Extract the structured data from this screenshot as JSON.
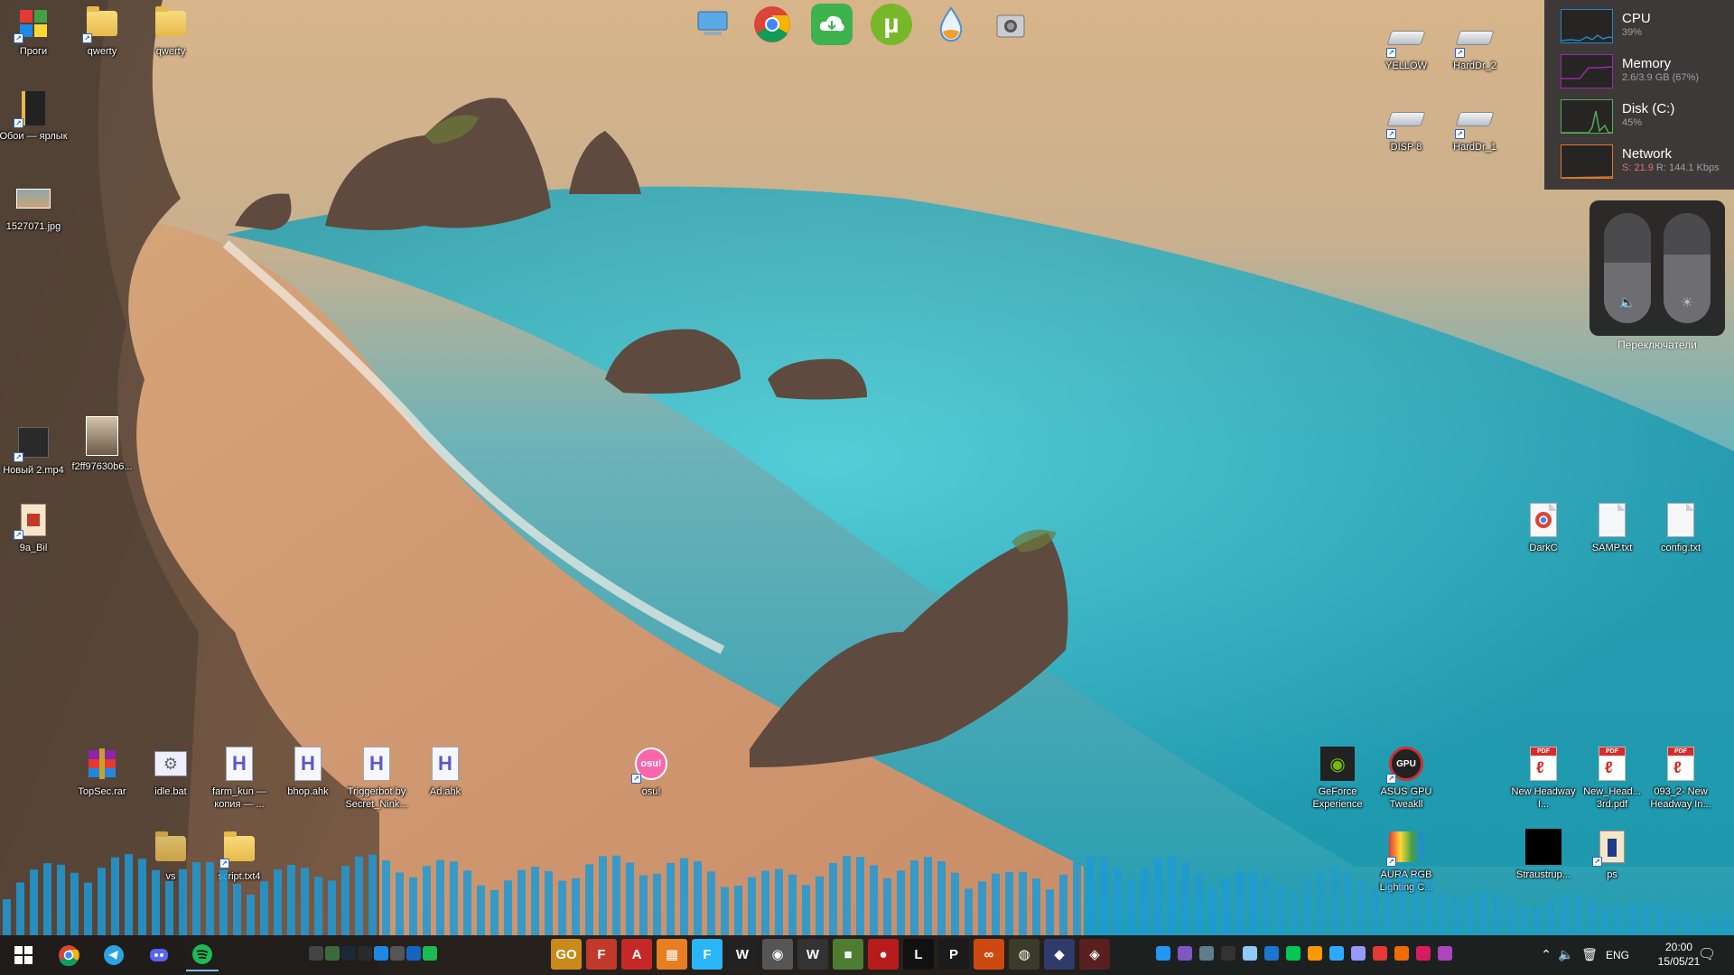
{
  "colors": {
    "accent_cpu": "#1e88c8",
    "accent_memory": "#9c27b0",
    "accent_disk": "#4caf50",
    "accent_network": "#e0782c",
    "visualizer_bar": "#1e9ad6",
    "taskbar_bg": "#1c1a18"
  },
  "desktop": {
    "left_icons": [
      {
        "label": "Проги",
        "icon": "apps-cube-icon"
      },
      {
        "label": "qwerty",
        "icon": "folder-icon"
      },
      {
        "label": "qwerty",
        "icon": "folder-icon"
      },
      {
        "label": "Обои — ярлык",
        "icon": "folder-shortcut-icon"
      },
      {
        "label": "1527071.jpg",
        "icon": "image-icon"
      },
      {
        "label": "Новый 2.mp4",
        "icon": "video-icon"
      },
      {
        "label": "f2ff97630b6...",
        "icon": "image-icon"
      },
      {
        "label": "9a_Bil",
        "icon": "archive-icon"
      }
    ],
    "bottom_icons": [
      {
        "label": "TopSec.rar",
        "icon": "winrar-icon"
      },
      {
        "label": "idle.bat",
        "icon": "batch-gear-icon"
      },
      {
        "label": "farm_kun — копия — ...",
        "icon": "ahk-file-icon"
      },
      {
        "label": "bhop.ahk",
        "icon": "ahk-file-icon"
      },
      {
        "label": "Triggerbot by Secret_Nink...",
        "icon": "ahk-file-icon"
      },
      {
        "label": "Ad.ahk",
        "icon": "ahk-file-icon"
      },
      {
        "label": "osu!",
        "icon": "osu-icon"
      },
      {
        "label": "vs",
        "icon": "folder-icon"
      },
      {
        "label": "script.txt4",
        "icon": "text-file-icon"
      }
    ],
    "drives": [
      {
        "label": "YELLOW"
      },
      {
        "label": "HardDr_2"
      },
      {
        "label": "DISP 8"
      },
      {
        "label": "HardDr_1"
      }
    ],
    "right_files": [
      {
        "label": "DarkC",
        "icon": "chrome-file-icon"
      },
      {
        "label": "SAMP.txt",
        "icon": "text-file-icon"
      },
      {
        "label": "config.txt",
        "icon": "text-file-icon"
      }
    ],
    "right_bottom": [
      {
        "label": "GeForce Experience",
        "icon": "nvidia-icon"
      },
      {
        "label": "ASUS GPU Tweakll",
        "icon": "asus-gpu-icon"
      },
      {
        "label": "New Headway I...",
        "icon": "pdf-icon"
      },
      {
        "label": "New_Head... 3rd.pdf",
        "icon": "pdf-icon"
      },
      {
        "label": "093_2- New Headway In...",
        "icon": "pdf-icon"
      },
      {
        "label": "AURA RGB Lighting C...",
        "icon": "aura-icon"
      },
      {
        "label": "Straustrup...",
        "icon": "black-file-icon"
      },
      {
        "label": "ps",
        "icon": "archive-icon"
      }
    ],
    "osu_badge": "osu!"
  },
  "dock": {
    "items": [
      {
        "name": "this-pc-icon"
      },
      {
        "name": "chrome-icon"
      },
      {
        "name": "cloud-download-icon"
      },
      {
        "name": "utorrent-icon"
      },
      {
        "name": "water-drop-icon"
      },
      {
        "name": "camera-icon"
      }
    ],
    "utorrent_glyph": "µ"
  },
  "monitor": {
    "cpu": {
      "title": "CPU",
      "value": "39%"
    },
    "memory": {
      "title": "Memory",
      "value": "2.6/3.9 GB (67%)"
    },
    "disk": {
      "title": "Disk (C:)",
      "value": "45%"
    },
    "network": {
      "title": "Network",
      "value_s": "S: 21.9",
      "value_r": "R: 144.1 Kbps"
    }
  },
  "switches": {
    "label": "Переключатели",
    "volume_level": 0.55,
    "brightness_level": 0.62
  },
  "taskbar": {
    "pinned": [
      "start-icon",
      "chrome-icon",
      "telegram-icon",
      "discord-icon",
      "spotify-icon"
    ],
    "tray_small": [
      "tray-app-1",
      "tray-app-2",
      "steam-icon",
      "epic-icon",
      "tray-app-3",
      "tray-app-4",
      "tray-app-5",
      "spotify-small-icon"
    ],
    "apps": [
      {
        "name": "csgo-app",
        "text": "GO",
        "color": "#c98a1a"
      },
      {
        "name": "forza-app",
        "text": "F",
        "color": "#c0392b"
      },
      {
        "name": "autocad-app",
        "text": "A",
        "color": "#c62828"
      },
      {
        "name": "blender-app",
        "text": "▦",
        "color": "#e67e22"
      },
      {
        "name": "f-app",
        "text": "F",
        "color": "#29b6f6"
      },
      {
        "name": "w-app",
        "text": "W",
        "color": "#222222"
      },
      {
        "name": "game-app-1",
        "text": "◉",
        "color": "#555555"
      },
      {
        "name": "watchdogs-app",
        "text": "W",
        "color": "#333333"
      },
      {
        "name": "minecraft-app",
        "text": "■",
        "color": "#4e7d2f"
      },
      {
        "name": "among-us-app",
        "text": "●",
        "color": "#b71c1c"
      },
      {
        "name": "l-app",
        "text": "L",
        "color": "#111111"
      },
      {
        "name": "p-app",
        "text": "P",
        "color": "#1b1b1b"
      },
      {
        "name": "infinity-app",
        "text": "∞",
        "color": "#cc4a10"
      },
      {
        "name": "game-app-2",
        "text": "◍",
        "color": "#3b3b2a"
      },
      {
        "name": "game-app-3",
        "text": "◆",
        "color": "#2e3b6b"
      },
      {
        "name": "game-app-4",
        "text": "◈",
        "color": "#5a2020"
      }
    ],
    "right_small": [
      "vscode-icon",
      "visual-studio-icon",
      "app-icon",
      "terminal-icon",
      "file-icon",
      "settings-icon",
      "audition-icon",
      "illustrator-icon",
      "photoshop-icon",
      "premiere-icon",
      "chrome-tray-icon",
      "app2-icon",
      "app3-icon",
      "app4-icon"
    ],
    "lang": "ENG",
    "time": "20:00",
    "date": "15/05/21"
  }
}
